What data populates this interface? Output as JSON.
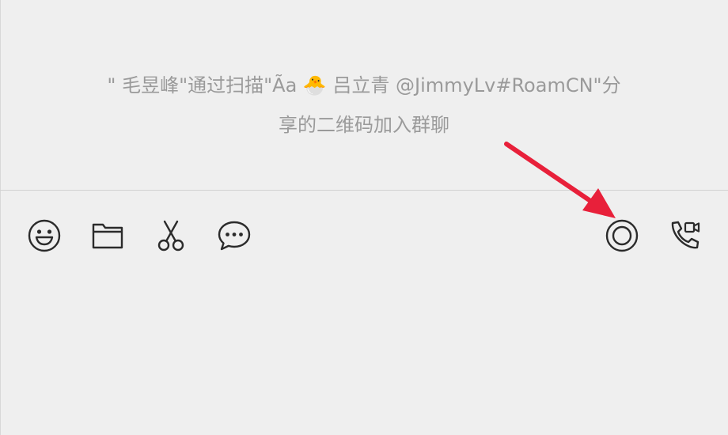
{
  "chat": {
    "system_message": {
      "line1": "\" 毛昱峰\"通过扫描\"Ãa 🐣 吕立青 @JimmyLv#RoamCN\"分",
      "line2": "享的二维码加入群聊"
    }
  },
  "toolbar": {
    "left_tools": [
      {
        "icon": "emoji-icon"
      },
      {
        "icon": "folder-icon"
      },
      {
        "icon": "scissors-icon"
      },
      {
        "icon": "chat-bubble-icon"
      }
    ],
    "right_tools": [
      {
        "icon": "record-icon"
      },
      {
        "icon": "call-video-icon"
      }
    ]
  },
  "colors": {
    "background": "#efefef",
    "text_muted": "#9a9a9a",
    "icon": "#2b2b2b",
    "arrow": "#e8203a"
  }
}
